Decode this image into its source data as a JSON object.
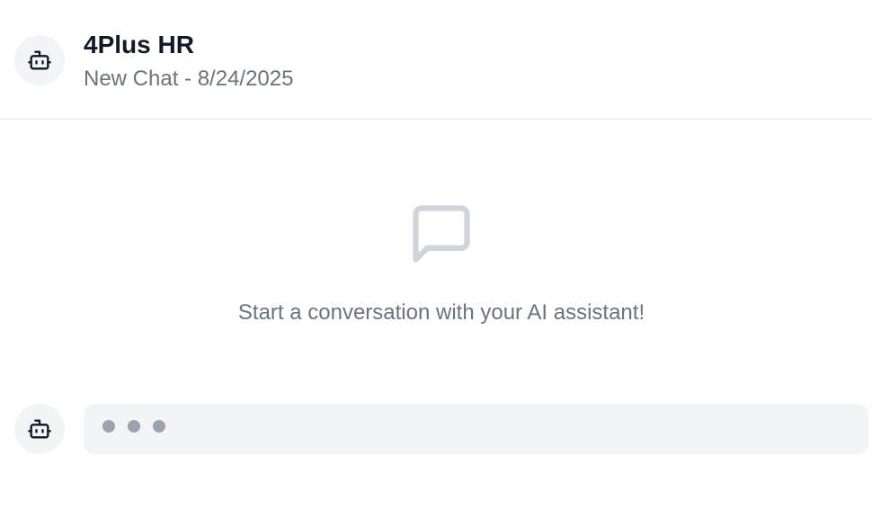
{
  "header": {
    "title": "4Plus HR",
    "subtitle": "New Chat - 8/24/2025",
    "avatar_icon": "robot-icon"
  },
  "empty_state": {
    "icon": "chat-bubble-icon",
    "message": "Start a conversation with your AI assistant!"
  },
  "typing_indicator": {
    "avatar_icon": "robot-icon",
    "dot_count": 3
  },
  "colors": {
    "title": "#111827",
    "muted_text": "#6b7280",
    "avatar_bg": "#f3f4f6",
    "bubble_bg": "#f3f4f6",
    "dot": "#9ca3af",
    "divider": "#e5e7eb",
    "icon_stroke": "#d1d5db"
  }
}
